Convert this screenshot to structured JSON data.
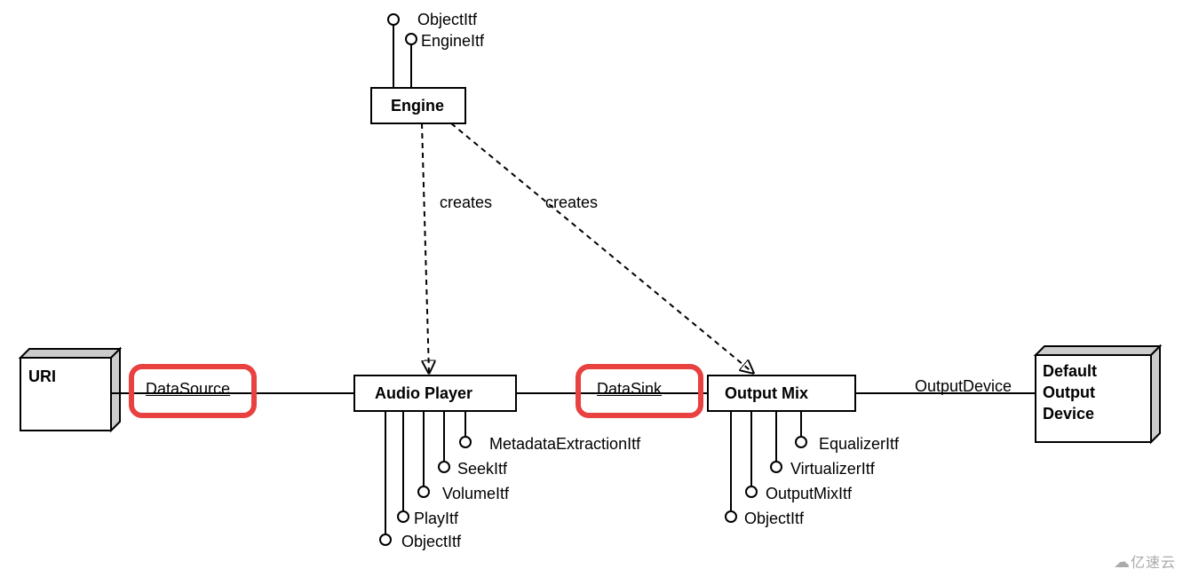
{
  "nodes": {
    "engine": {
      "label": "Engine"
    },
    "audio_player": {
      "label": "Audio Player"
    },
    "output_mix": {
      "label": "Output Mix"
    },
    "uri": {
      "label": "URI"
    },
    "default_output_device": {
      "line1": "Default",
      "line2": "Output",
      "line3": "Device"
    }
  },
  "edges": {
    "engine_to_audioplayer": {
      "label": "creates"
    },
    "engine_to_outputmix": {
      "label": "creates"
    },
    "uri_to_audioplayer": {
      "label": "DataSource"
    },
    "audioplayer_to_outputmix": {
      "label": "DataSink"
    },
    "outputmix_to_device": {
      "label": "OutputDevice"
    }
  },
  "interfaces": {
    "engine": [
      {
        "name": "ObjectItf"
      },
      {
        "name": "EngineItf"
      }
    ],
    "audio_player": [
      {
        "name": "ObjectItf"
      },
      {
        "name": "PlayItf"
      },
      {
        "name": "VolumeItf"
      },
      {
        "name": "SeekItf"
      },
      {
        "name": "MetadataExtractionItf"
      }
    ],
    "output_mix": [
      {
        "name": "ObjectItf"
      },
      {
        "name": "OutputMixItf"
      },
      {
        "name": "VirtualizerItf"
      },
      {
        "name": "EqualizerItf"
      }
    ]
  },
  "highlights": {
    "data_source": {
      "color": "#e8413f"
    },
    "data_sink": {
      "color": "#e8413f"
    }
  },
  "watermark": "亿速云"
}
